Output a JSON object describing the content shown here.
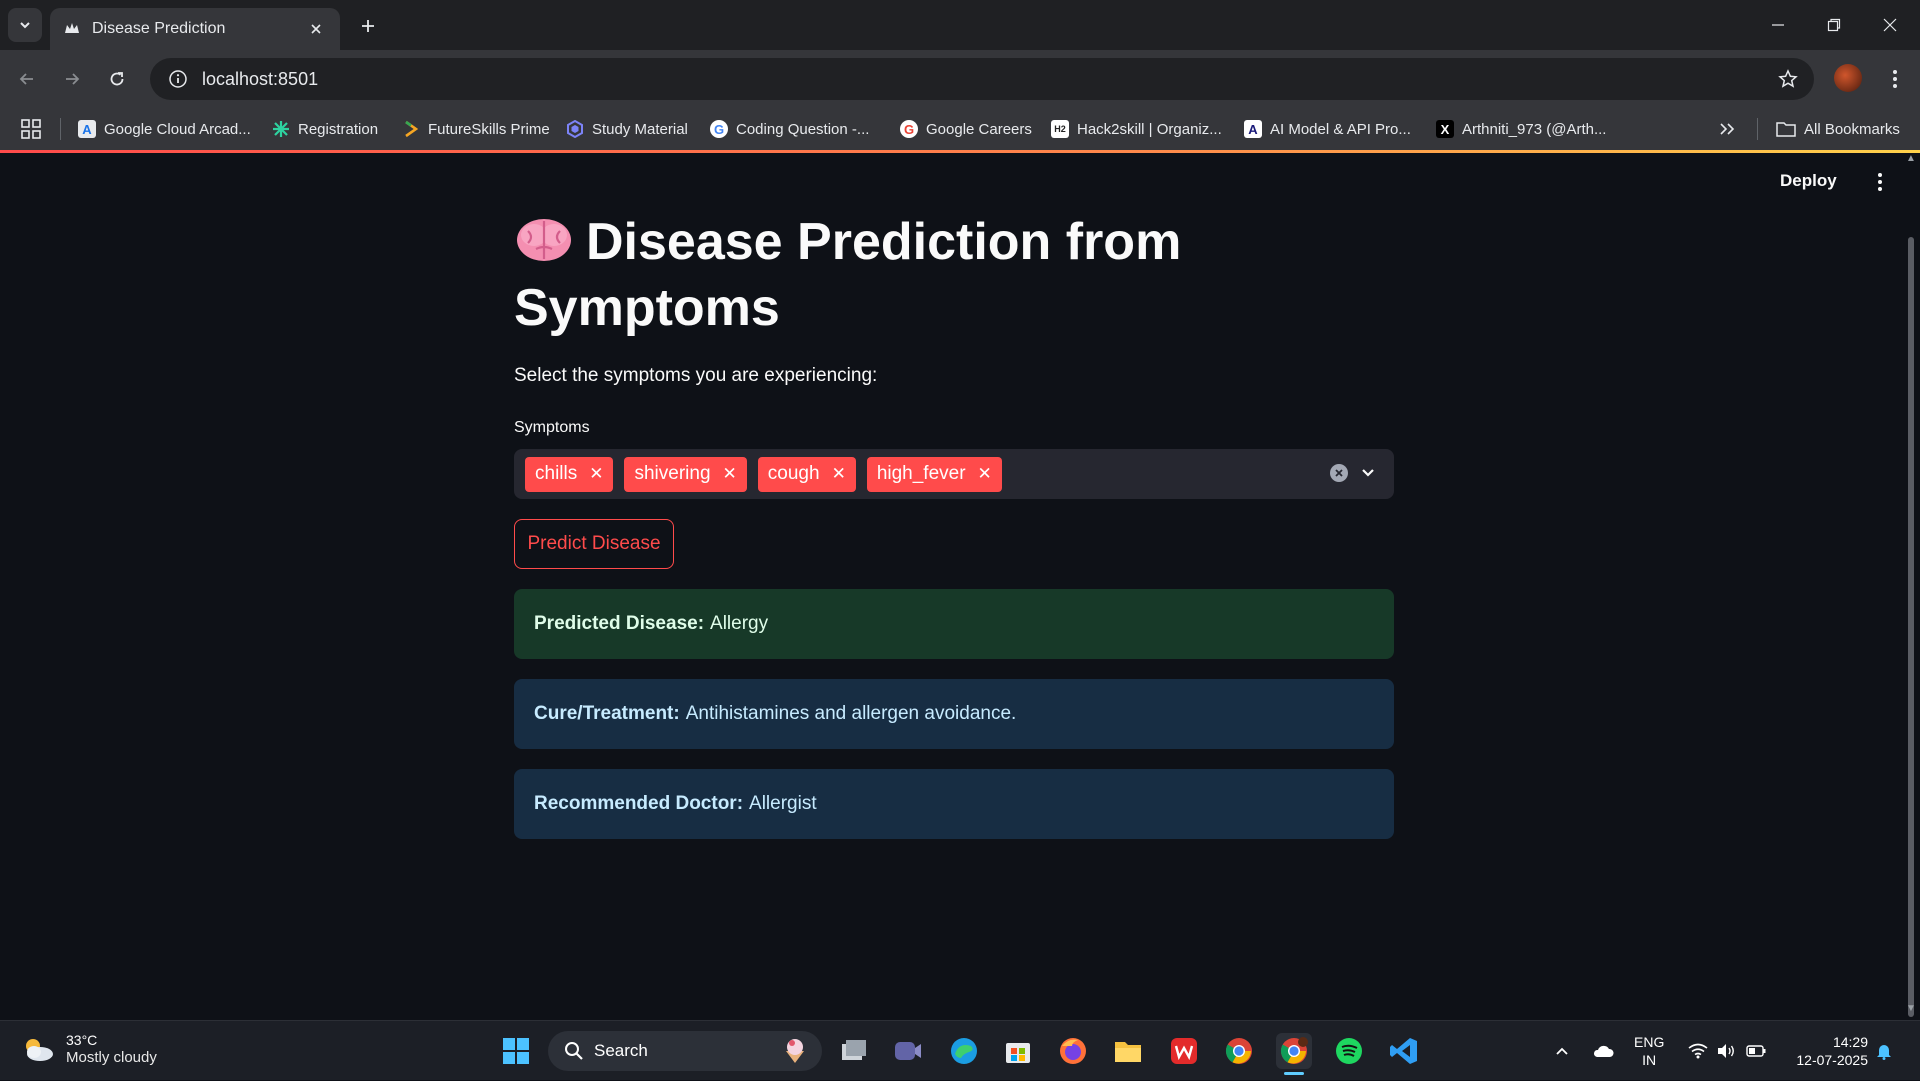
{
  "browser": {
    "tab_title": "Disease Prediction",
    "url": "localhost:8501",
    "bookmarks": [
      {
        "label": "Google Cloud Arcad...",
        "icon": "arcade-icon"
      },
      {
        "label": "Registration",
        "icon": "registration-icon"
      },
      {
        "label": "FutureSkills Prime",
        "icon": "futureskills-icon"
      },
      {
        "label": "Study Material",
        "icon": "study-icon"
      },
      {
        "label": "Coding Question -...",
        "icon": "google-icon"
      },
      {
        "label": "Google Careers",
        "icon": "google-icon"
      },
      {
        "label": "Hack2skill | Organiz...",
        "icon": "hack2skill-icon"
      },
      {
        "label": "AI Model & API Pro...",
        "icon": "ai-model-icon"
      },
      {
        "label": "Arthniti_973 (@Arth...",
        "icon": "x-icon"
      }
    ],
    "all_bookmarks": "All Bookmarks"
  },
  "app": {
    "deploy_label": "Deploy",
    "title": "Disease Prediction from Symptoms",
    "title_emoji": "brain-icon",
    "subtitle": "Select the symptoms you are experiencing:",
    "symptoms_label": "Symptoms",
    "selected_symptoms": [
      "chills",
      "shivering",
      "cough",
      "high_fever"
    ],
    "predict_button": "Predict Disease",
    "results": {
      "disease_label": "Predicted Disease:",
      "disease_value": "Allergy",
      "cure_label": "Cure/Treatment:",
      "cure_value": "Antihistamines and allergen avoidance.",
      "doctor_label": "Recommended Doctor:",
      "doctor_value": "Allergist"
    },
    "colors": {
      "primary": "#ff4b4b",
      "background": "#0e1117",
      "success_bg": "#173928",
      "info_bg": "#172d43"
    }
  },
  "taskbar": {
    "weather_temp": "33°C",
    "weather_desc": "Mostly cloudy",
    "search_label": "Search",
    "lang_line1": "ENG",
    "lang_line2": "IN",
    "time": "14:29",
    "date": "12-07-2025"
  }
}
